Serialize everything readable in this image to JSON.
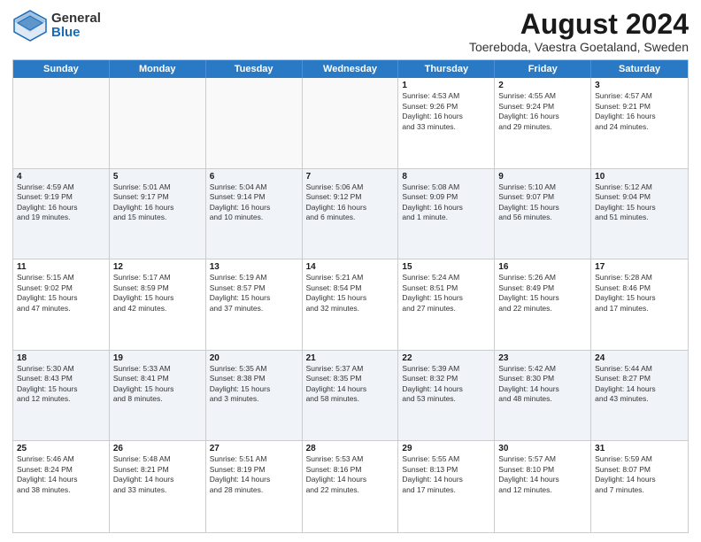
{
  "header": {
    "title": "August 2024",
    "subtitle": "Toereboda, Vaestra Goetaland, Sweden",
    "logo_general": "General",
    "logo_blue": "Blue"
  },
  "calendar": {
    "days_of_week": [
      "Sunday",
      "Monday",
      "Tuesday",
      "Wednesday",
      "Thursday",
      "Friday",
      "Saturday"
    ],
    "weeks": [
      {
        "alt": false,
        "cells": [
          {
            "day": "",
            "info": ""
          },
          {
            "day": "",
            "info": ""
          },
          {
            "day": "",
            "info": ""
          },
          {
            "day": "",
            "info": ""
          },
          {
            "day": "1",
            "info": "Sunrise: 4:53 AM\nSunset: 9:26 PM\nDaylight: 16 hours\nand 33 minutes."
          },
          {
            "day": "2",
            "info": "Sunrise: 4:55 AM\nSunset: 9:24 PM\nDaylight: 16 hours\nand 29 minutes."
          },
          {
            "day": "3",
            "info": "Sunrise: 4:57 AM\nSunset: 9:21 PM\nDaylight: 16 hours\nand 24 minutes."
          }
        ]
      },
      {
        "alt": true,
        "cells": [
          {
            "day": "4",
            "info": "Sunrise: 4:59 AM\nSunset: 9:19 PM\nDaylight: 16 hours\nand 19 minutes."
          },
          {
            "day": "5",
            "info": "Sunrise: 5:01 AM\nSunset: 9:17 PM\nDaylight: 16 hours\nand 15 minutes."
          },
          {
            "day": "6",
            "info": "Sunrise: 5:04 AM\nSunset: 9:14 PM\nDaylight: 16 hours\nand 10 minutes."
          },
          {
            "day": "7",
            "info": "Sunrise: 5:06 AM\nSunset: 9:12 PM\nDaylight: 16 hours\nand 6 minutes."
          },
          {
            "day": "8",
            "info": "Sunrise: 5:08 AM\nSunset: 9:09 PM\nDaylight: 16 hours\nand 1 minute."
          },
          {
            "day": "9",
            "info": "Sunrise: 5:10 AM\nSunset: 9:07 PM\nDaylight: 15 hours\nand 56 minutes."
          },
          {
            "day": "10",
            "info": "Sunrise: 5:12 AM\nSunset: 9:04 PM\nDaylight: 15 hours\nand 51 minutes."
          }
        ]
      },
      {
        "alt": false,
        "cells": [
          {
            "day": "11",
            "info": "Sunrise: 5:15 AM\nSunset: 9:02 PM\nDaylight: 15 hours\nand 47 minutes."
          },
          {
            "day": "12",
            "info": "Sunrise: 5:17 AM\nSunset: 8:59 PM\nDaylight: 15 hours\nand 42 minutes."
          },
          {
            "day": "13",
            "info": "Sunrise: 5:19 AM\nSunset: 8:57 PM\nDaylight: 15 hours\nand 37 minutes."
          },
          {
            "day": "14",
            "info": "Sunrise: 5:21 AM\nSunset: 8:54 PM\nDaylight: 15 hours\nand 32 minutes."
          },
          {
            "day": "15",
            "info": "Sunrise: 5:24 AM\nSunset: 8:51 PM\nDaylight: 15 hours\nand 27 minutes."
          },
          {
            "day": "16",
            "info": "Sunrise: 5:26 AM\nSunset: 8:49 PM\nDaylight: 15 hours\nand 22 minutes."
          },
          {
            "day": "17",
            "info": "Sunrise: 5:28 AM\nSunset: 8:46 PM\nDaylight: 15 hours\nand 17 minutes."
          }
        ]
      },
      {
        "alt": true,
        "cells": [
          {
            "day": "18",
            "info": "Sunrise: 5:30 AM\nSunset: 8:43 PM\nDaylight: 15 hours\nand 12 minutes."
          },
          {
            "day": "19",
            "info": "Sunrise: 5:33 AM\nSunset: 8:41 PM\nDaylight: 15 hours\nand 8 minutes."
          },
          {
            "day": "20",
            "info": "Sunrise: 5:35 AM\nSunset: 8:38 PM\nDaylight: 15 hours\nand 3 minutes."
          },
          {
            "day": "21",
            "info": "Sunrise: 5:37 AM\nSunset: 8:35 PM\nDaylight: 14 hours\nand 58 minutes."
          },
          {
            "day": "22",
            "info": "Sunrise: 5:39 AM\nSunset: 8:32 PM\nDaylight: 14 hours\nand 53 minutes."
          },
          {
            "day": "23",
            "info": "Sunrise: 5:42 AM\nSunset: 8:30 PM\nDaylight: 14 hours\nand 48 minutes."
          },
          {
            "day": "24",
            "info": "Sunrise: 5:44 AM\nSunset: 8:27 PM\nDaylight: 14 hours\nand 43 minutes."
          }
        ]
      },
      {
        "alt": false,
        "cells": [
          {
            "day": "25",
            "info": "Sunrise: 5:46 AM\nSunset: 8:24 PM\nDaylight: 14 hours\nand 38 minutes."
          },
          {
            "day": "26",
            "info": "Sunrise: 5:48 AM\nSunset: 8:21 PM\nDaylight: 14 hours\nand 33 minutes."
          },
          {
            "day": "27",
            "info": "Sunrise: 5:51 AM\nSunset: 8:19 PM\nDaylight: 14 hours\nand 28 minutes."
          },
          {
            "day": "28",
            "info": "Sunrise: 5:53 AM\nSunset: 8:16 PM\nDaylight: 14 hours\nand 22 minutes."
          },
          {
            "day": "29",
            "info": "Sunrise: 5:55 AM\nSunset: 8:13 PM\nDaylight: 14 hours\nand 17 minutes."
          },
          {
            "day": "30",
            "info": "Sunrise: 5:57 AM\nSunset: 8:10 PM\nDaylight: 14 hours\nand 12 minutes."
          },
          {
            "day": "31",
            "info": "Sunrise: 5:59 AM\nSunset: 8:07 PM\nDaylight: 14 hours\nand 7 minutes."
          }
        ]
      }
    ]
  }
}
